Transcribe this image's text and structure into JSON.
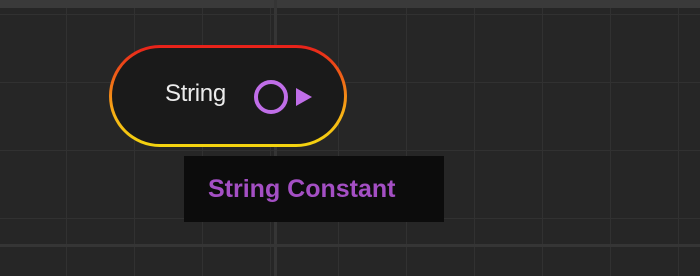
{
  "node": {
    "label": "String",
    "pin_icon": "output-pin-icon"
  },
  "tooltip": {
    "text": "String Constant"
  },
  "colors": {
    "canvas_bg": "#262626",
    "grid_line": "#313131",
    "node_fill": "#1a1a1a",
    "node_border_top": "#e8201a",
    "node_border_bottom": "#f3d40f",
    "pin_color": "#c06ee8",
    "tooltip_bg": "#0c0c0c",
    "tooltip_text": "#a44fc4"
  }
}
